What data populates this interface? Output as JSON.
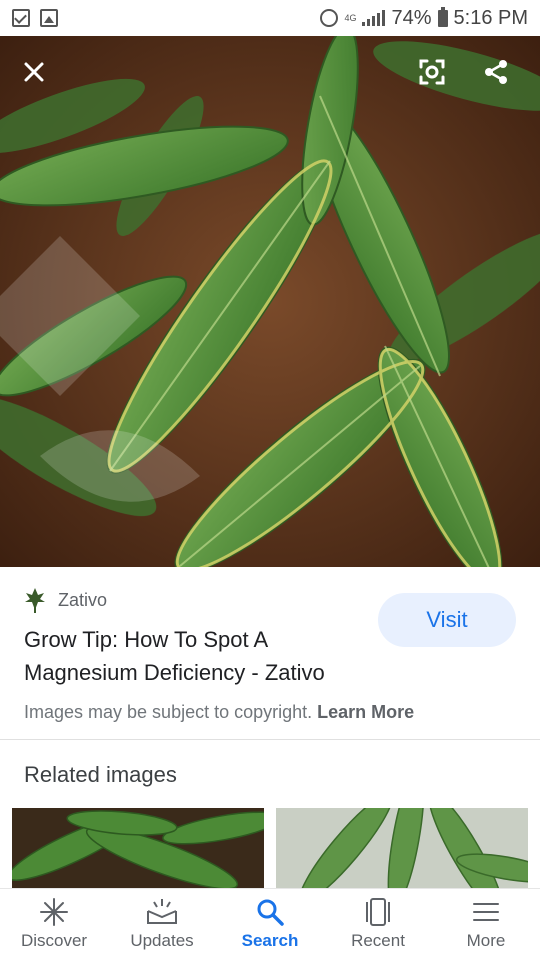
{
  "status_bar": {
    "battery": "74%",
    "time": "5:16 PM",
    "network": "4G"
  },
  "viewer": {
    "close_icon": "close-icon",
    "lens_icon": "lens-icon",
    "share_icon": "share-icon"
  },
  "result": {
    "source": "Zativo",
    "title": "Grow Tip: How To Spot A Magnesium Deficiency - Zativo",
    "visit_label": "Visit",
    "copyright_text": "Images may be subject to copyright.",
    "learn_more_label": "Learn More"
  },
  "related": {
    "title": "Related images"
  },
  "nav": {
    "items": [
      {
        "label": "Discover",
        "icon": "discover-icon"
      },
      {
        "label": "Updates",
        "icon": "updates-icon"
      },
      {
        "label": "Search",
        "icon": "search-icon"
      },
      {
        "label": "Recent",
        "icon": "recent-icon"
      },
      {
        "label": "More",
        "icon": "menu-icon"
      }
    ],
    "active": "Search"
  },
  "colors": {
    "accent": "#1a73e8",
    "visit_bg": "#e8f0fe",
    "leaf": "#4f8a3a",
    "soil": "#5a3520"
  }
}
